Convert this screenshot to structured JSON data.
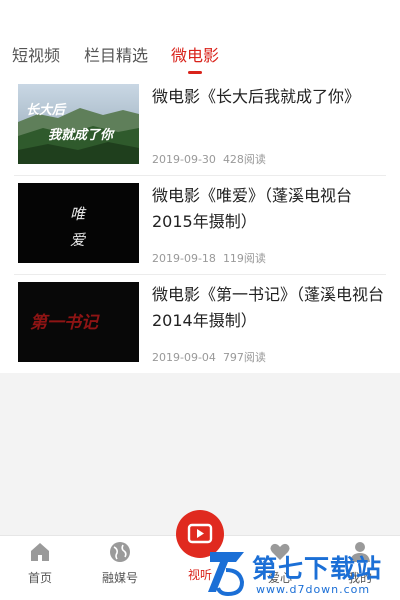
{
  "tabs": [
    {
      "label": "短视频",
      "active": false
    },
    {
      "label": "栏目精选",
      "active": false
    },
    {
      "label": "微电影",
      "active": true
    }
  ],
  "accent_color": "#d9231b",
  "videos": [
    {
      "title": "微电影《长大后我就成了你》",
      "date": "2019-09-30",
      "reads": "428阅读",
      "thumb_text": "长大后我就成了你"
    },
    {
      "title": "微电影《唯爱》（蓬溪电视台2015年摄制）",
      "date": "2019-09-18",
      "reads": "119阅读",
      "thumb_text": "唯爱"
    },
    {
      "title": "微电影《第一书记》（蓬溪电视台2014年摄制）",
      "date": "2019-09-04",
      "reads": "797阅读",
      "thumb_text": "第一书记"
    }
  ],
  "bottom_nav": [
    {
      "label": "首页",
      "icon": "home-icon"
    },
    {
      "label": "融媒号",
      "icon": "globe-icon"
    },
    {
      "label": "视听",
      "icon": "video-play-icon",
      "active": true
    },
    {
      "label": "爱心",
      "icon": "heart-icon"
    },
    {
      "label": "我的",
      "icon": "user-icon"
    }
  ],
  "watermark": {
    "title": "第七下载站",
    "url": "www.d7down.com"
  }
}
